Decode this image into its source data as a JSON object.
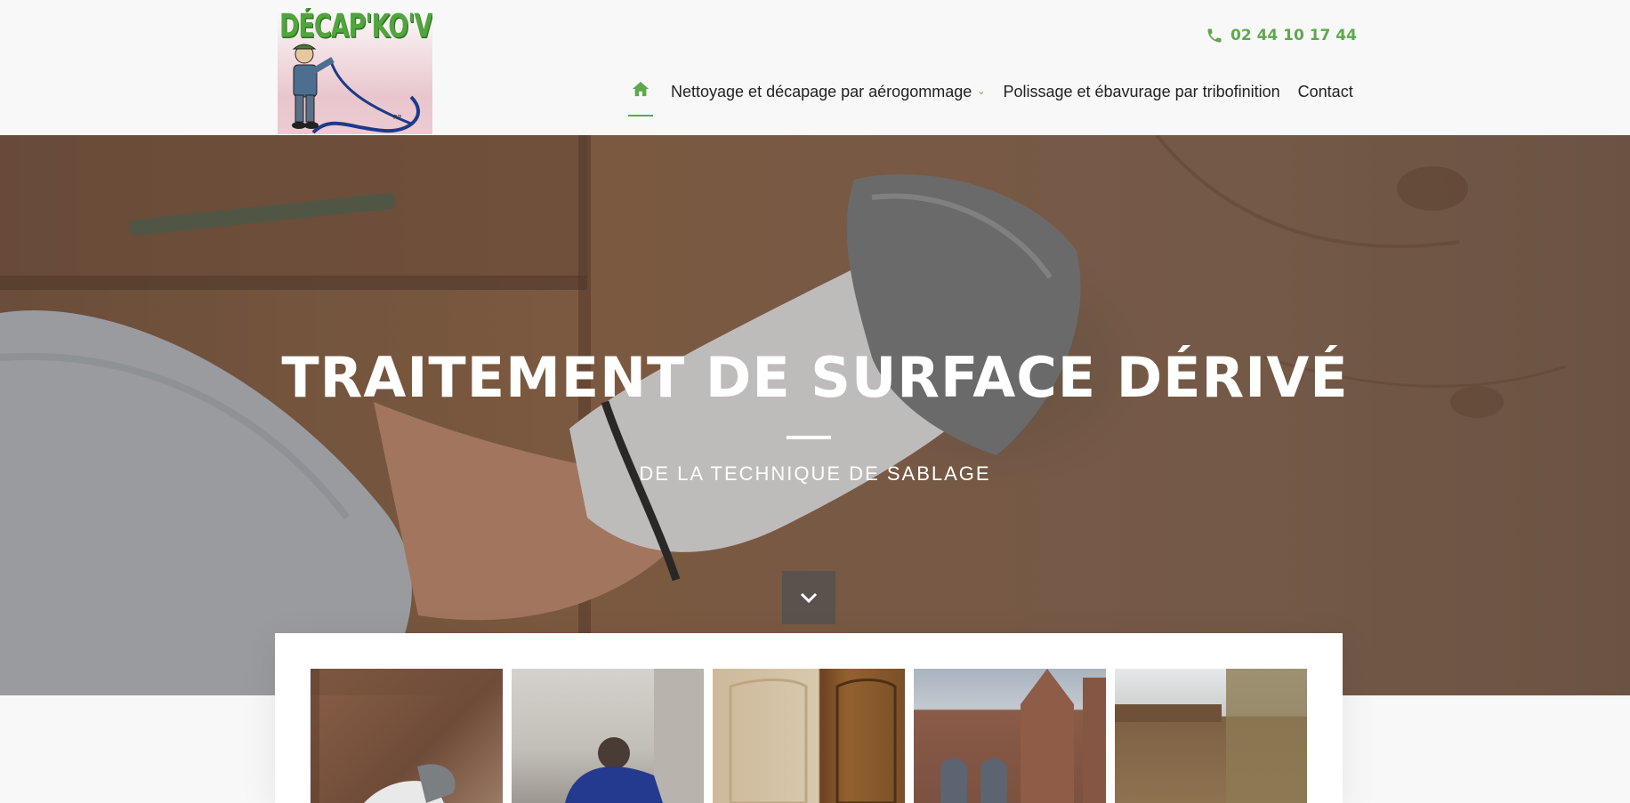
{
  "header": {
    "logo_text": "DÉCAP'KO'VERT",
    "phone": "02 44 10 17 44",
    "nav": {
      "home_icon": "home-icon",
      "items": [
        {
          "label": "Nettoyage et décapage par aérogommage",
          "has_dropdown": true
        },
        {
          "label": "Polissage et ébavurage par tribofinition",
          "has_dropdown": false
        },
        {
          "label": "Contact",
          "has_dropdown": false
        }
      ]
    }
  },
  "hero": {
    "title": "TRAITEMENT DE SURFACE DÉRIVÉ",
    "subtitle": "DE LA TECHNIQUE DE SABLAGE",
    "scroll_icon": "chevron-down-icon"
  },
  "gallery": {
    "thumbnails": [
      {
        "name": "thumb-wood-cleaning"
      },
      {
        "name": "thumb-worker-blasting"
      },
      {
        "name": "thumb-doors"
      },
      {
        "name": "thumb-church"
      },
      {
        "name": "thumb-bench"
      }
    ]
  },
  "colors": {
    "accent": "#5fa84e",
    "text": "#222222",
    "background": "#f8f8f8"
  }
}
